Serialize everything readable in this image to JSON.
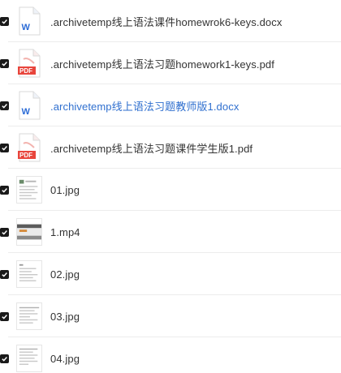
{
  "files": [
    {
      "name": ".archivetemp线上语法课件homewrok6-keys.docx",
      "kind": "word",
      "icon": "word-doc-icon",
      "checked": true
    },
    {
      "name": ".archivetemp线上语法习题homework1-keys.pdf",
      "kind": "pdf",
      "icon": "pdf-icon",
      "checked": true
    },
    {
      "name": ".archivetemp线上语法习题教师版1.docx",
      "kind": "word",
      "icon": "word-doc-icon",
      "checked": true,
      "highlighted": true
    },
    {
      "name": ".archivetemp线上语法习题课件学生版1.pdf",
      "kind": "pdf",
      "icon": "pdf-icon",
      "checked": true
    },
    {
      "name": "01.jpg",
      "kind": "image",
      "icon": "image-thumbnail",
      "checked": true
    },
    {
      "name": "1.mp4",
      "kind": "video",
      "icon": "video-thumbnail",
      "checked": true
    },
    {
      "name": "02.jpg",
      "kind": "image",
      "icon": "image-thumbnail",
      "checked": true
    },
    {
      "name": "03.jpg",
      "kind": "image",
      "icon": "image-thumbnail",
      "checked": true
    },
    {
      "name": "04.jpg",
      "kind": "image",
      "icon": "image-thumbnail",
      "checked": true
    }
  ],
  "icon_labels": {
    "word": "W",
    "pdf": "PDF"
  },
  "colors": {
    "word_blue": "#2b6bd6",
    "pdf_red": "#e8453c",
    "highlight_text": "#2f6fcf",
    "checkbox": "#1a1a1a"
  }
}
